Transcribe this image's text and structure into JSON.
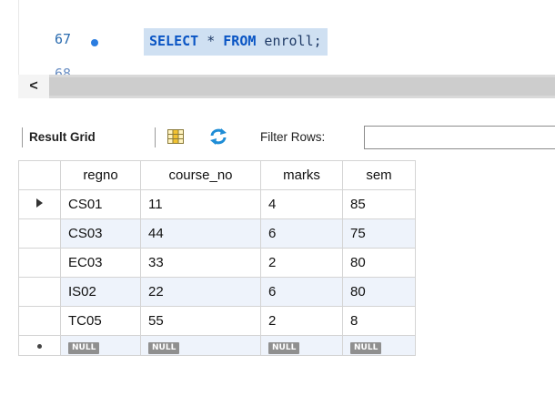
{
  "editor": {
    "line_number": "67",
    "keyword_select": "SELECT",
    "star": " * ",
    "keyword_from": "FROM",
    "rest": " enroll;"
  },
  "scrollbar": {
    "left_arrow": "<"
  },
  "toolbar": {
    "result_grid_label": "Result Grid",
    "filter_rows_label": "Filter Rows:",
    "filter_value": ""
  },
  "grid": {
    "columns": [
      "regno",
      "course_no",
      "marks",
      "sem"
    ],
    "rows": [
      [
        "CS01",
        "11",
        "4",
        "85"
      ],
      [
        "CS03",
        "44",
        "6",
        "75"
      ],
      [
        "EC03",
        "33",
        "2",
        "80"
      ],
      [
        "IS02",
        "22",
        "6",
        "80"
      ],
      [
        "TC05",
        "55",
        "2",
        "8"
      ]
    ],
    "null_label": "NULL"
  }
}
